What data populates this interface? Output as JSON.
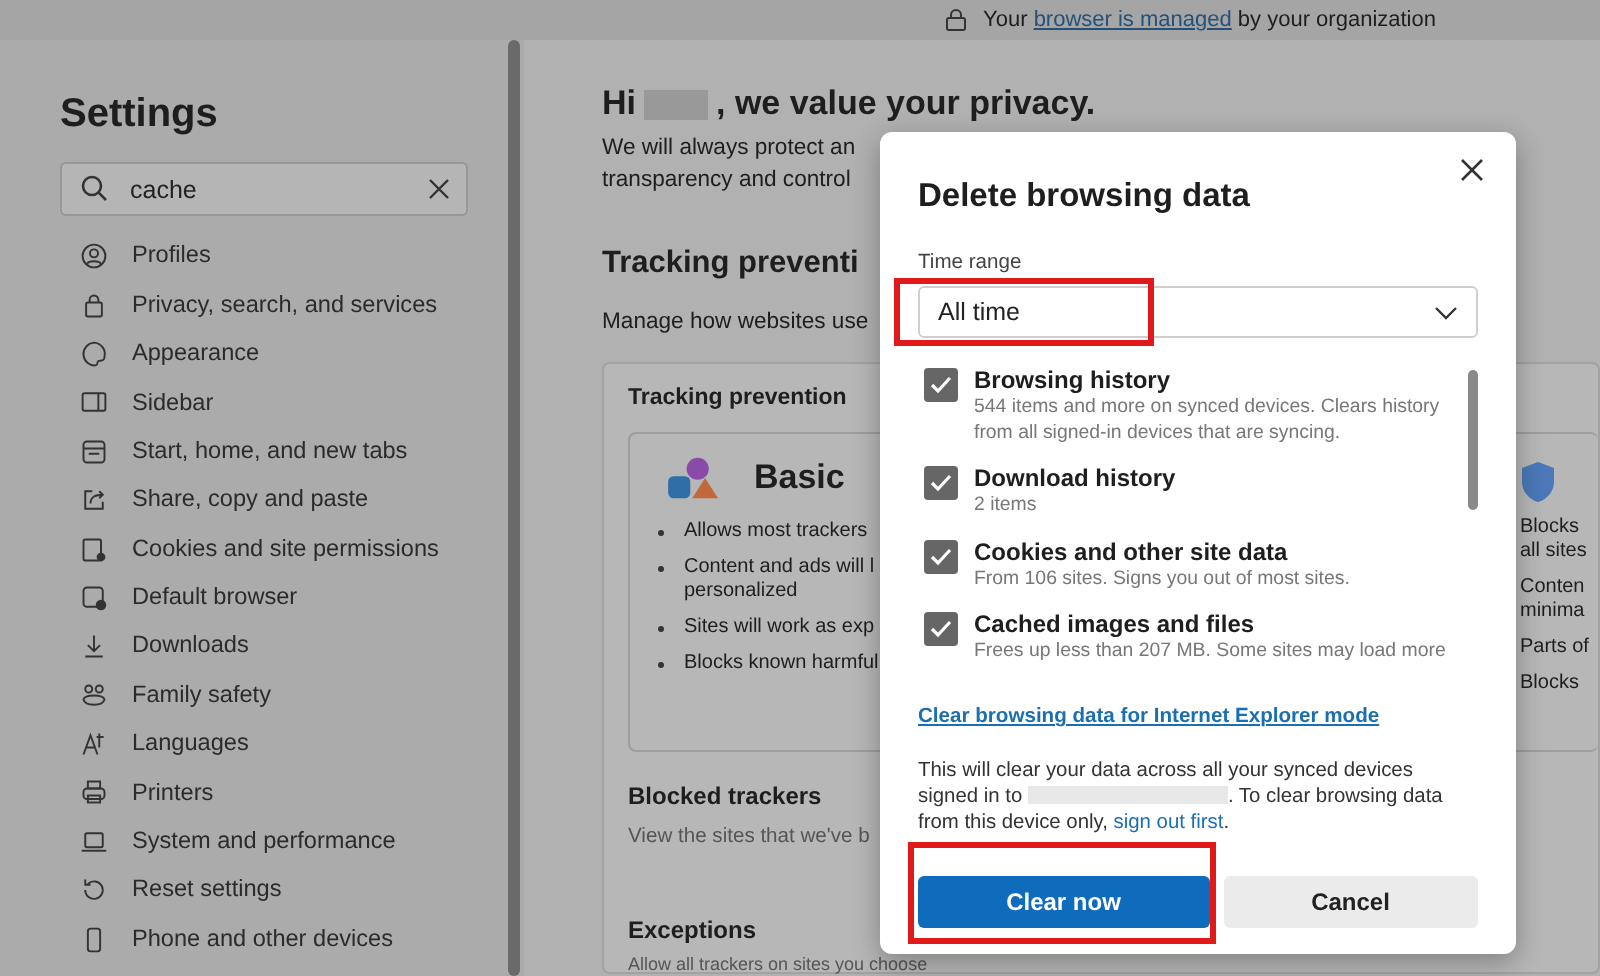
{
  "top_bar": {
    "notice_before": "Your",
    "notice_link": "browser is managed",
    "notice_after": "by your organization"
  },
  "sidebar": {
    "title": "Settings",
    "search": {
      "value": "cache"
    },
    "items": [
      {
        "label": "Profiles"
      },
      {
        "label": "Privacy, search, and services"
      },
      {
        "label": "Appearance"
      },
      {
        "label": "Sidebar"
      },
      {
        "label": "Start, home, and new tabs"
      },
      {
        "label": "Share, copy and paste"
      },
      {
        "label": "Cookies and site permissions"
      },
      {
        "label": "Default browser"
      },
      {
        "label": "Downloads"
      },
      {
        "label": "Family safety"
      },
      {
        "label": "Languages"
      },
      {
        "label": "Printers"
      },
      {
        "label": "System and performance"
      },
      {
        "label": "Reset settings"
      },
      {
        "label": "Phone and other devices"
      }
    ]
  },
  "main": {
    "greeting_before": "Hi",
    "greeting_after": ", we value your privacy.",
    "intro_lines": [
      "We will always protect an",
      "transparency and control"
    ],
    "section_title": "Tracking preventi",
    "section_desc": "Manage how websites use",
    "card": {
      "title": "Tracking prevention",
      "options": [
        {
          "title": "Basic",
          "bulleted": true,
          "bullets": [
            [
              "Allows most trackers"
            ],
            [
              "Content and ads will l",
              "personalized"
            ],
            [
              "Sites will work as exp"
            ],
            [
              "Blocks known harmful"
            ]
          ]
        },
        {
          "bulleted": false,
          "bullets": [
            [
              "Blocks",
              "all sites"
            ],
            [
              "Conten",
              "minima"
            ],
            [
              "Parts of"
            ],
            [
              "Blocks"
            ]
          ]
        }
      ],
      "blocked_title": "Blocked trackers",
      "blocked_desc": "View the sites that we've b",
      "exceptions_title": "Exceptions",
      "exceptions_desc": "Allow all trackers on sites you choose"
    }
  },
  "dialog": {
    "title": "Delete browsing data",
    "time_range": {
      "label": "Time range",
      "value": "All time",
      "highlighted": true
    },
    "items": [
      {
        "title": "Browsing history",
        "desc": "544 items and more on synced devices. Clears history from all signed-in devices that are syncing.",
        "checked": true
      },
      {
        "title": "Download history",
        "desc": "2 items",
        "checked": true
      },
      {
        "title": "Cookies and other site data",
        "desc": "From 106 sites. Signs you out of most sites.",
        "checked": true
      },
      {
        "title": "Cached images and files",
        "desc": "Frees up less than 207 MB. Some sites may load more",
        "checked": true
      }
    ],
    "ie_link": "Clear browsing data for Internet Explorer mode",
    "note": {
      "before": "This will clear your data across all your synced devices signed in to",
      "middle": ". To clear browsing data from this device only,",
      "link": "sign out first",
      "after": "."
    },
    "buttons": [
      {
        "label": "Clear now",
        "kind": "primary",
        "highlighted": true
      },
      {
        "label": "Cancel",
        "kind": "secondary",
        "highlighted": false
      }
    ]
  }
}
